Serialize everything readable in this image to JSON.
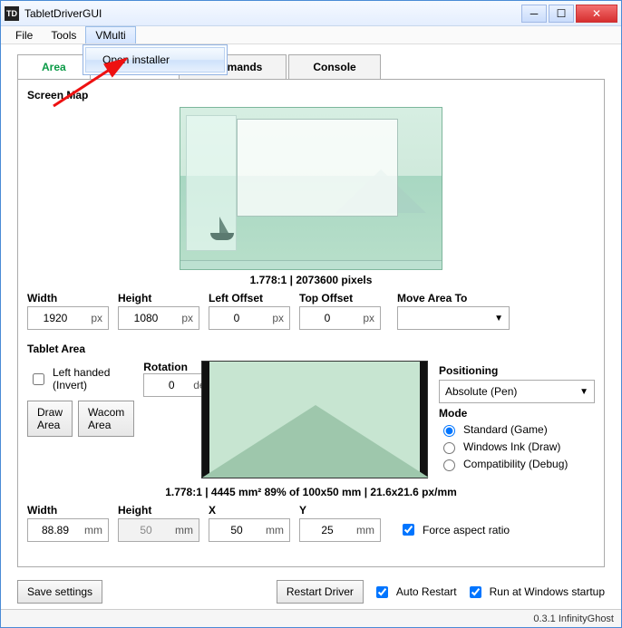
{
  "window": {
    "title": "TabletDriverGUI"
  },
  "menu": {
    "file": "File",
    "tools": "Tools",
    "vmulti": "VMulti",
    "vmulti_items": {
      "open_installer": "Open installer"
    }
  },
  "tabs": {
    "area": "Area",
    "commands": "Commands",
    "console": "Console"
  },
  "screen_map": {
    "title": "Screen Map",
    "info": "1.778:1 | 2073600 pixels",
    "width_label": "Width",
    "height_label": "Height",
    "left_offset_label": "Left Offset",
    "top_offset_label": "Top Offset",
    "move_label": "Move Area To",
    "width": "1920",
    "height": "1080",
    "left_offset": "0",
    "top_offset": "0",
    "unit": "px",
    "move_value": ""
  },
  "tablet_area": {
    "title": "Tablet Area",
    "left_handed": "Left handed (Invert)",
    "rotation_label": "Rotation",
    "rotation": "0",
    "rotation_unit": "deg",
    "draw_area_btn": "Draw Area",
    "wacom_area_btn": "Wacom Area",
    "positioning_label": "Positioning",
    "positioning_value": "Absolute (Pen)",
    "mode_label": "Mode",
    "mode_standard": "Standard (Game)",
    "mode_wintab": "Windows Ink (Draw)",
    "mode_compat": "Compatibility (Debug)",
    "info": "1.778:1 | 4445 mm² 89% of 100x50 mm | 21.6x21.6 px/mm",
    "width_label": "Width",
    "height_label": "Height",
    "x_label": "X",
    "y_label": "Y",
    "width": "88.89",
    "height": "50",
    "x": "50",
    "y": "25",
    "unit": "mm",
    "force_ratio": "Force aspect ratio"
  },
  "bottom": {
    "save": "Save settings",
    "restart": "Restart Driver",
    "auto_restart": "Auto Restart",
    "run_startup": "Run at Windows startup"
  },
  "status": "0.3.1 InfinityGhost"
}
